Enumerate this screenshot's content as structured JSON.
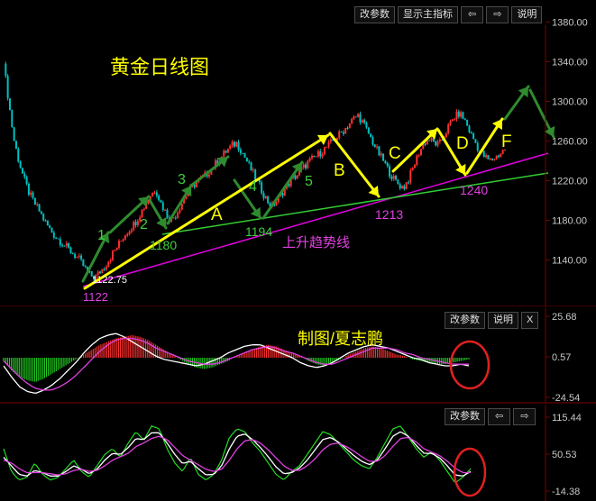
{
  "toolbar_main": {
    "modify_params": "改参数",
    "show_main_indicator": "显示主指标",
    "left_arrow": "⇦",
    "right_arrow": "⇨",
    "help": "说明"
  },
  "toolbar_macd": {
    "modify_params": "改参数",
    "help": "说明",
    "close": "X"
  },
  "toolbar_osc": {
    "modify_params": "改参数",
    "left_arrow": "⇦",
    "right_arrow": "⇨"
  },
  "colors": {
    "up_candle": "#ff3030",
    "down_candle": "#00c0c0",
    "yellow_arrow": "#ffff00",
    "green_arrow": "#2e8b2e",
    "trendline_magenta": "#e000e0",
    "trendline_green": "#33cc33",
    "label_magenta": "#e040e0",
    "label_yellow": "#ffff00",
    "label_green": "#3fcf3f",
    "highlight_circle": "#e02020",
    "axis_text": "#c8c8c8",
    "panel_border": "#5a0000"
  },
  "chart_data": [
    {
      "type": "candlestick",
      "title": "黄金日线图",
      "y_ticks": [
        "1380.00",
        "1340.00",
        "1300.00",
        "1260.00",
        "1220.00",
        "1180.00",
        "1140.00"
      ],
      "ylim": [
        1095,
        1395
      ],
      "close_path": [
        1338,
        1300,
        1262,
        1240,
        1222,
        1208,
        1198,
        1190,
        1180,
        1172,
        1165,
        1160,
        1155,
        1150,
        1145,
        1140,
        1132,
        1125,
        1122,
        1128,
        1134,
        1142,
        1150,
        1158,
        1166,
        1172,
        1178,
        1187,
        1196,
        1205,
        1212,
        1198,
        1188,
        1180,
        1186,
        1196,
        1205,
        1212,
        1218,
        1222,
        1226,
        1232,
        1238,
        1244,
        1250,
        1255,
        1258,
        1250,
        1240,
        1230,
        1220,
        1210,
        1200,
        1194,
        1200,
        1208,
        1215,
        1222,
        1226,
        1232,
        1238,
        1242,
        1246,
        1250,
        1255,
        1260,
        1265,
        1270,
        1276,
        1282,
        1286,
        1278,
        1268,
        1258,
        1248,
        1240,
        1230,
        1222,
        1216,
        1213,
        1222,
        1235,
        1248,
        1258,
        1262,
        1258,
        1256,
        1266,
        1276,
        1284,
        1288,
        1282,
        1270,
        1260,
        1250,
        1244,
        1240,
        1243,
        1247,
        1252
      ],
      "price_labels": [
        "1122",
        "1122.75",
        "1180",
        "1194",
        "1213",
        "1240"
      ],
      "wave_labels_green": [
        "1",
        "2",
        "3",
        "4",
        "5"
      ],
      "wave_labels_yellow": [
        "A",
        "B",
        "C",
        "D",
        "F"
      ],
      "trendline_label": "上升趋势线",
      "author_label": "制图/夏志鹏"
    },
    {
      "type": "histogram_with_lines",
      "y_ticks": [
        "25.68",
        "0.57",
        "-24.54"
      ],
      "ylim": [
        -24.54,
        25.68
      ],
      "histogram_path": [
        -2,
        -8,
        -12,
        -14,
        -15,
        -13,
        -10,
        -7,
        -4,
        -1,
        2,
        5,
        8,
        10,
        12,
        13,
        14,
        13,
        11,
        8,
        5,
        2,
        -1,
        -4,
        -6,
        -7,
        -6,
        -4,
        -2,
        1,
        3,
        5,
        7,
        8,
        7,
        5,
        3,
        1,
        -2,
        -4,
        -5,
        -3,
        -1,
        2,
        4,
        6,
        7,
        6,
        4,
        2,
        1,
        -1,
        -2,
        -3,
        -4,
        -4,
        -3,
        -2,
        -1
      ],
      "line1_path": [
        -5,
        -12,
        -18,
        -21,
        -22,
        -20,
        -17,
        -13,
        -8,
        -3,
        3,
        8,
        12,
        14,
        15,
        13,
        10,
        7,
        4,
        1,
        -1,
        -2,
        -3,
        -4,
        -5,
        -4,
        -2,
        0,
        3,
        5,
        7,
        8,
        8,
        6,
        4,
        2,
        0,
        -3,
        -5,
        -6,
        -5,
        -3,
        0,
        3,
        5,
        7,
        8,
        7,
        6,
        4,
        2,
        0,
        -1,
        -3,
        -4,
        -5,
        -5,
        -4,
        -5
      ],
      "line2_path": [
        -2,
        -7,
        -12,
        -16,
        -19,
        -20,
        -20,
        -18,
        -15,
        -11,
        -6,
        -1,
        4,
        8,
        11,
        12,
        12,
        11,
        9,
        6,
        4,
        2,
        0,
        -2,
        -3,
        -4,
        -4,
        -3,
        -1,
        1,
        3,
        5,
        6,
        7,
        6,
        4,
        3,
        1,
        -1,
        -3,
        -4,
        -4,
        -2,
        0,
        2,
        4,
        6,
        6,
        6,
        5,
        3,
        2,
        0,
        -1,
        -2,
        -3,
        -4,
        -4,
        -4
      ]
    },
    {
      "type": "line",
      "y_ticks": [
        "115.44",
        "50.53",
        "-14.38"
      ],
      "ylim": [
        -14.38,
        115.44
      ],
      "green_path": [
        60,
        20,
        5,
        10,
        35,
        15,
        5,
        10,
        25,
        40,
        20,
        10,
        30,
        50,
        60,
        45,
        70,
        90,
        75,
        100,
        95,
        60,
        35,
        20,
        45,
        15,
        5,
        15,
        40,
        80,
        95,
        90,
        70,
        55,
        35,
        15,
        5,
        20,
        30,
        50,
        70,
        90,
        85,
        70,
        55,
        40,
        30,
        25,
        45,
        70,
        95,
        100,
        80,
        60,
        45,
        55,
        40,
        20,
        0,
        10,
        25
      ],
      "white_path": [
        45,
        30,
        15,
        12,
        22,
        18,
        12,
        12,
        20,
        30,
        24,
        16,
        24,
        40,
        52,
        50,
        62,
        78,
        76,
        88,
        88,
        70,
        50,
        34,
        38,
        25,
        14,
        15,
        30,
        60,
        82,
        86,
        76,
        62,
        46,
        28,
        16,
        18,
        26,
        40,
        58,
        76,
        80,
        72,
        60,
        48,
        38,
        32,
        40,
        60,
        82,
        90,
        82,
        66,
        52,
        52,
        44,
        30,
        14,
        12,
        20
      ],
      "purple_path": [
        40,
        35,
        25,
        18,
        18,
        18,
        16,
        14,
        16,
        22,
        24,
        20,
        22,
        30,
        40,
        46,
        52,
        64,
        70,
        78,
        82,
        76,
        62,
        48,
        40,
        32,
        24,
        20,
        24,
        40,
        60,
        74,
        76,
        70,
        58,
        44,
        30,
        22,
        22,
        30,
        42,
        58,
        68,
        70,
        64,
        56,
        46,
        38,
        38,
        48,
        64,
        78,
        80,
        72,
        60,
        54,
        48,
        38,
        26,
        18,
        18
      ]
    }
  ]
}
